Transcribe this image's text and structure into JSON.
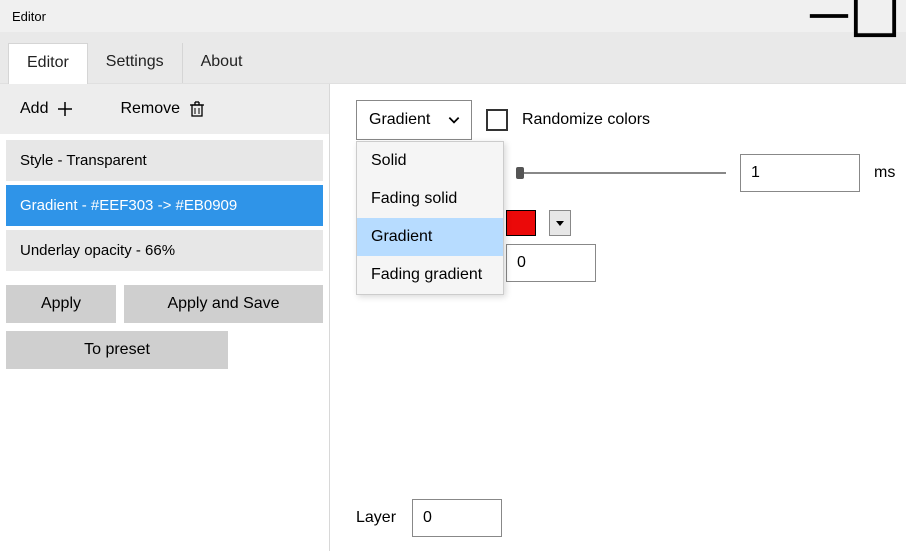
{
  "window": {
    "title": "Editor"
  },
  "tabs": {
    "editor": "Editor",
    "settings": "Settings",
    "about": "About",
    "active": "editor"
  },
  "toolbar": {
    "add": "Add",
    "remove": "Remove"
  },
  "list": {
    "items": [
      {
        "label": "Style - Transparent"
      },
      {
        "label": "Gradient - #EEF303 -> #EB0909"
      },
      {
        "label": "Underlay opacity - 66%"
      }
    ],
    "selected_index": 1
  },
  "buttons": {
    "apply": "Apply",
    "apply_save": "Apply and Save",
    "to_preset": "To preset"
  },
  "fill": {
    "combo_value": "Gradient",
    "options": [
      "Solid",
      "Fading solid",
      "Gradient",
      "Fading gradient"
    ],
    "selected_option_index": 2,
    "randomize_label": "Randomize colors",
    "randomize_checked": false,
    "slider_value": "1",
    "slider_unit": "ms",
    "color_hex": "#EB0909",
    "width_value": "0"
  },
  "layer": {
    "label": "Layer",
    "value": "0"
  }
}
